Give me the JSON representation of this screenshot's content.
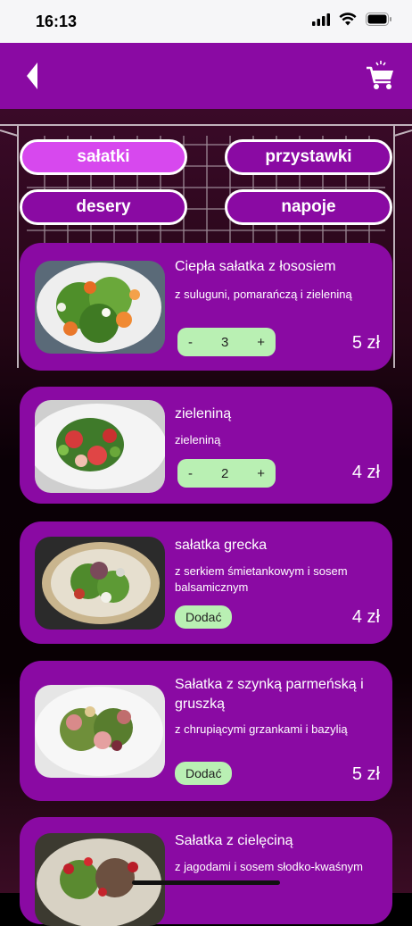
{
  "status_bar": {
    "time": "16:13"
  },
  "app_bar": {
    "back_icon": "chevron-left-icon",
    "cart_icon": "cart-icon"
  },
  "categories": [
    {
      "label": "sałatki",
      "active": true
    },
    {
      "label": "przystawki",
      "active": false
    },
    {
      "label": "desery",
      "active": false
    },
    {
      "label": "napoje",
      "active": false
    }
  ],
  "products": [
    {
      "title": "Ciepła sałatka z łososiem",
      "description": "z suluguni, pomarańczą i zieleniną",
      "quantity": "3",
      "minus": "-",
      "plus": "+",
      "price": "5 zł"
    },
    {
      "title": "zieleniną",
      "description": "zieleniną",
      "quantity": "2",
      "minus": "-",
      "plus": "+",
      "price": "4 zł"
    },
    {
      "title": "sałatka grecka",
      "description": "z serkiem śmietankowym i sosem balsamicznym",
      "add_label": "Dodać",
      "price": "4 zł"
    },
    {
      "title": "Sałatka z szynką parmeńską i gruszką",
      "description": "z chrupiącymi grzankami i bazylią",
      "add_label": "Dodać",
      "price": "5 zł"
    },
    {
      "title": "Sałatka z cielęciną",
      "description": "z jagodami i sosem słodko-kwaśnym"
    }
  ],
  "colors": {
    "primary": "#8a0aa3",
    "active_tab": "#d748ee",
    "button_green": "#b9f0b3"
  }
}
